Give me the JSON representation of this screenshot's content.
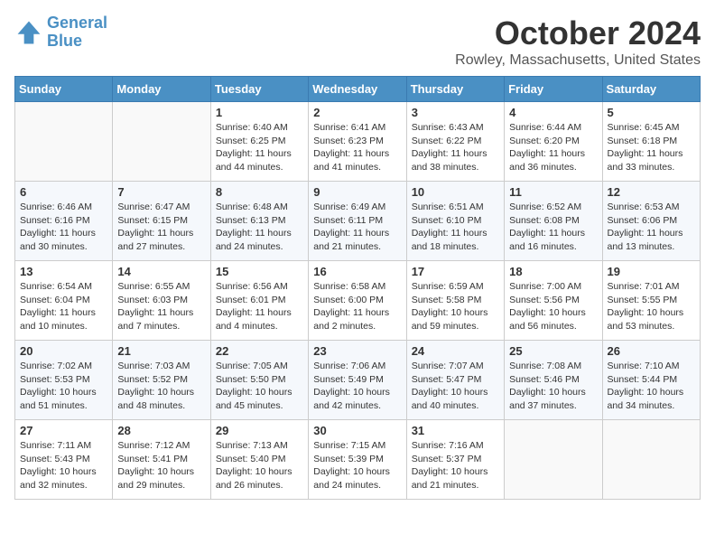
{
  "logo": {
    "line1": "General",
    "line2": "Blue"
  },
  "title": "October 2024",
  "subtitle": "Rowley, Massachusetts, United States",
  "days_of_week": [
    "Sunday",
    "Monday",
    "Tuesday",
    "Wednesday",
    "Thursday",
    "Friday",
    "Saturday"
  ],
  "weeks": [
    [
      {
        "day": "",
        "info": ""
      },
      {
        "day": "",
        "info": ""
      },
      {
        "day": "1",
        "info": "Sunrise: 6:40 AM\nSunset: 6:25 PM\nDaylight: 11 hours and 44 minutes."
      },
      {
        "day": "2",
        "info": "Sunrise: 6:41 AM\nSunset: 6:23 PM\nDaylight: 11 hours and 41 minutes."
      },
      {
        "day": "3",
        "info": "Sunrise: 6:43 AM\nSunset: 6:22 PM\nDaylight: 11 hours and 38 minutes."
      },
      {
        "day": "4",
        "info": "Sunrise: 6:44 AM\nSunset: 6:20 PM\nDaylight: 11 hours and 36 minutes."
      },
      {
        "day": "5",
        "info": "Sunrise: 6:45 AM\nSunset: 6:18 PM\nDaylight: 11 hours and 33 minutes."
      }
    ],
    [
      {
        "day": "6",
        "info": "Sunrise: 6:46 AM\nSunset: 6:16 PM\nDaylight: 11 hours and 30 minutes."
      },
      {
        "day": "7",
        "info": "Sunrise: 6:47 AM\nSunset: 6:15 PM\nDaylight: 11 hours and 27 minutes."
      },
      {
        "day": "8",
        "info": "Sunrise: 6:48 AM\nSunset: 6:13 PM\nDaylight: 11 hours and 24 minutes."
      },
      {
        "day": "9",
        "info": "Sunrise: 6:49 AM\nSunset: 6:11 PM\nDaylight: 11 hours and 21 minutes."
      },
      {
        "day": "10",
        "info": "Sunrise: 6:51 AM\nSunset: 6:10 PM\nDaylight: 11 hours and 18 minutes."
      },
      {
        "day": "11",
        "info": "Sunrise: 6:52 AM\nSunset: 6:08 PM\nDaylight: 11 hours and 16 minutes."
      },
      {
        "day": "12",
        "info": "Sunrise: 6:53 AM\nSunset: 6:06 PM\nDaylight: 11 hours and 13 minutes."
      }
    ],
    [
      {
        "day": "13",
        "info": "Sunrise: 6:54 AM\nSunset: 6:04 PM\nDaylight: 11 hours and 10 minutes."
      },
      {
        "day": "14",
        "info": "Sunrise: 6:55 AM\nSunset: 6:03 PM\nDaylight: 11 hours and 7 minutes."
      },
      {
        "day": "15",
        "info": "Sunrise: 6:56 AM\nSunset: 6:01 PM\nDaylight: 11 hours and 4 minutes."
      },
      {
        "day": "16",
        "info": "Sunrise: 6:58 AM\nSunset: 6:00 PM\nDaylight: 11 hours and 2 minutes."
      },
      {
        "day": "17",
        "info": "Sunrise: 6:59 AM\nSunset: 5:58 PM\nDaylight: 10 hours and 59 minutes."
      },
      {
        "day": "18",
        "info": "Sunrise: 7:00 AM\nSunset: 5:56 PM\nDaylight: 10 hours and 56 minutes."
      },
      {
        "day": "19",
        "info": "Sunrise: 7:01 AM\nSunset: 5:55 PM\nDaylight: 10 hours and 53 minutes."
      }
    ],
    [
      {
        "day": "20",
        "info": "Sunrise: 7:02 AM\nSunset: 5:53 PM\nDaylight: 10 hours and 51 minutes."
      },
      {
        "day": "21",
        "info": "Sunrise: 7:03 AM\nSunset: 5:52 PM\nDaylight: 10 hours and 48 minutes."
      },
      {
        "day": "22",
        "info": "Sunrise: 7:05 AM\nSunset: 5:50 PM\nDaylight: 10 hours and 45 minutes."
      },
      {
        "day": "23",
        "info": "Sunrise: 7:06 AM\nSunset: 5:49 PM\nDaylight: 10 hours and 42 minutes."
      },
      {
        "day": "24",
        "info": "Sunrise: 7:07 AM\nSunset: 5:47 PM\nDaylight: 10 hours and 40 minutes."
      },
      {
        "day": "25",
        "info": "Sunrise: 7:08 AM\nSunset: 5:46 PM\nDaylight: 10 hours and 37 minutes."
      },
      {
        "day": "26",
        "info": "Sunrise: 7:10 AM\nSunset: 5:44 PM\nDaylight: 10 hours and 34 minutes."
      }
    ],
    [
      {
        "day": "27",
        "info": "Sunrise: 7:11 AM\nSunset: 5:43 PM\nDaylight: 10 hours and 32 minutes."
      },
      {
        "day": "28",
        "info": "Sunrise: 7:12 AM\nSunset: 5:41 PM\nDaylight: 10 hours and 29 minutes."
      },
      {
        "day": "29",
        "info": "Sunrise: 7:13 AM\nSunset: 5:40 PM\nDaylight: 10 hours and 26 minutes."
      },
      {
        "day": "30",
        "info": "Sunrise: 7:15 AM\nSunset: 5:39 PM\nDaylight: 10 hours and 24 minutes."
      },
      {
        "day": "31",
        "info": "Sunrise: 7:16 AM\nSunset: 5:37 PM\nDaylight: 10 hours and 21 minutes."
      },
      {
        "day": "",
        "info": ""
      },
      {
        "day": "",
        "info": ""
      }
    ]
  ]
}
